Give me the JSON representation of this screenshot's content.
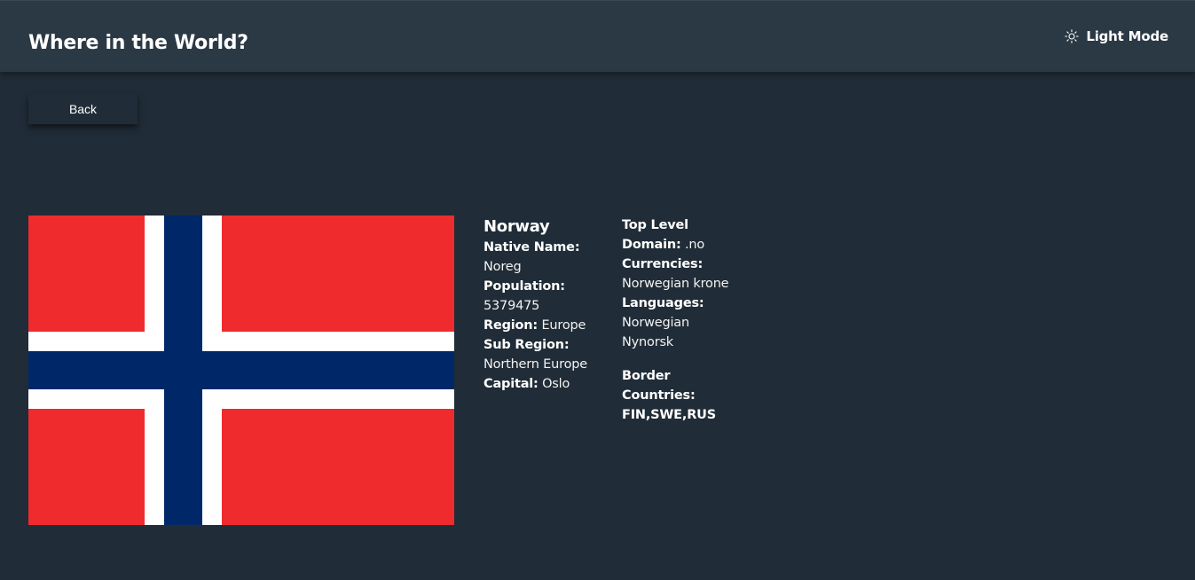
{
  "header": {
    "title": "Where in the World?",
    "mode_label": "Light Mode",
    "mode_icon": "sun-icon"
  },
  "back_label": "Back",
  "colors": {
    "background": "#202c37",
    "header": "#2b3945",
    "text": "#ffffff",
    "flag_red": "#ef2b2d",
    "flag_blue": "#002868",
    "flag_white": "#ffffff"
  },
  "country": {
    "name": "Norway",
    "flag_icon": "norway-flag",
    "native_name_label": "Native Name:",
    "native_name": "Noreg",
    "population_label": "Population:",
    "population": "5379475",
    "region_label": "Region:",
    "region": "Europe",
    "subregion_label": "Sub Region:",
    "subregion": "Northern Europe",
    "capital_label": "Capital:",
    "capital": "Oslo",
    "tld_label": "Top Level Domain:",
    "tld": ".no",
    "currencies_label": "Currencies:",
    "currencies": "Norwegian krone",
    "languages_label": "Languages:",
    "languages": "Norwegian Nynorsk",
    "borders_label": "Border Countries:",
    "borders": "FIN,SWE,RUS"
  }
}
